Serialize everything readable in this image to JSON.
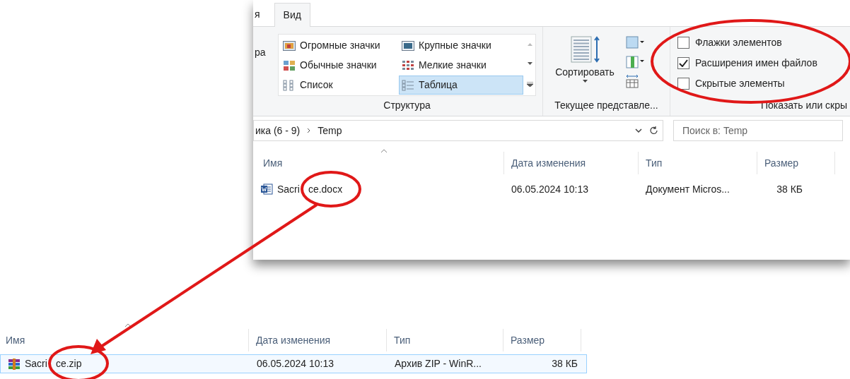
{
  "explorer_window": {
    "ribbon_tabs": [
      {
        "label": "я",
        "selected": false
      },
      {
        "label": "Вид",
        "selected": true
      }
    ],
    "ribbon_left_cut": "ра",
    "layout_group": {
      "label": "Структура",
      "items": [
        {
          "label": "Огромные значки",
          "kind": "huge",
          "selected": false
        },
        {
          "label": "Крупные значки",
          "kind": "large",
          "selected": false
        },
        {
          "label": "Обычные значки",
          "kind": "medium",
          "selected": false
        },
        {
          "label": "Мелкие значки",
          "kind": "small",
          "selected": false
        },
        {
          "label": "Список",
          "kind": "list",
          "selected": false
        },
        {
          "label": "Таблица",
          "kind": "details",
          "selected": true
        }
      ]
    },
    "current_view_group": {
      "label": "Текущее представле...",
      "sort_button": "Сортировать"
    },
    "show_hide_group": {
      "label": "Показать или скры",
      "options": [
        {
          "label": "Флажки элементов",
          "checked": false
        },
        {
          "label": "Расширения имен файлов",
          "checked": true
        },
        {
          "label": "Скрытые элементы",
          "checked": false
        }
      ]
    },
    "address_bar": {
      "path": [
        "ика (6 - 9)",
        "Temp"
      ]
    },
    "search": {
      "placeholder": "Поиск в: Temp"
    },
    "table": {
      "columns": [
        "Имя",
        "Дата изменения",
        "Тип",
        "Размер"
      ],
      "rows": [
        {
          "kind": "word",
          "selected": false,
          "cells": [
            [
              "Sacri",
              "ce.docx"
            ],
            "06.05.2024 10:13",
            "Документ Micros...",
            "38 КБ"
          ]
        }
      ]
    }
  },
  "archive_list": {
    "columns": [
      "Имя",
      "Дата изменения",
      "Тип",
      "Размер"
    ],
    "rows": [
      {
        "kind": "archive",
        "selected": true,
        "cells": [
          [
            "Sacri",
            "ce.zip"
          ],
          "06.05.2024 10:13",
          "Архив ZIP - WinR...",
          "38 КБ"
        ]
      }
    ]
  }
}
